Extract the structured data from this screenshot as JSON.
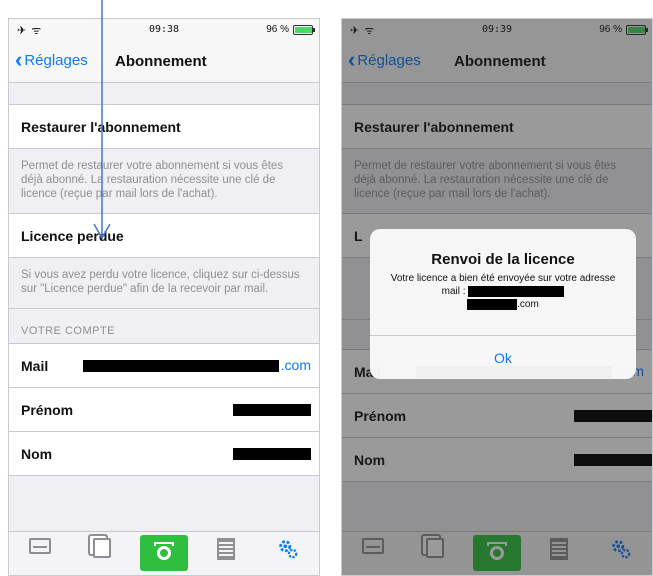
{
  "left": {
    "statusbar": {
      "time": "09:38",
      "battery": "96 %"
    },
    "navbar": {
      "back": "Réglages",
      "title": "Abonnement"
    },
    "restore": {
      "label": "Restaurer l'abonnement",
      "footer": "Permet de restaurer votre abonnement si vous êtes déjà abonné. La restauration nécessite une clé de licence (reçue par mail lors de l'achat)."
    },
    "lost": {
      "label": "Licence perdue",
      "footer": "Si vous avez perdu votre licence, cliquez sur ci-dessus sur \"Licence perdue\" afin de la recevoir par mail."
    },
    "account": {
      "header": "VOTRE COMPTE",
      "mail_label": "Mail",
      "mail_value_suffix": ".com",
      "firstname_label": "Prénom",
      "lastname_label": "Nom"
    }
  },
  "right": {
    "statusbar": {
      "time": "09:39",
      "battery": "96 %"
    },
    "navbar": {
      "back": "Réglages",
      "title": "Abonnement"
    },
    "restore": {
      "label": "Restaurer l'abonnement",
      "footer": "Permet de restaurer votre abonnement si vous êtes déjà abonné. La restauration nécessite une clé de licence (reçue par mail lors de l'achat)."
    },
    "account": {
      "mail_label": "Mail",
      "mail_value_suffix": "com",
      "firstname_label": "Prénom",
      "lastname_label": "Nom"
    },
    "alert": {
      "title": "Renvoi de la licence",
      "message": "Votre licence a bien été envoyée sur votre adresse mail :",
      "message_suffix": ".com",
      "ok": "Ok"
    }
  },
  "colors": {
    "accent": "#0a7aff",
    "camera": "#2fbf3f",
    "background": "#efeff4"
  }
}
